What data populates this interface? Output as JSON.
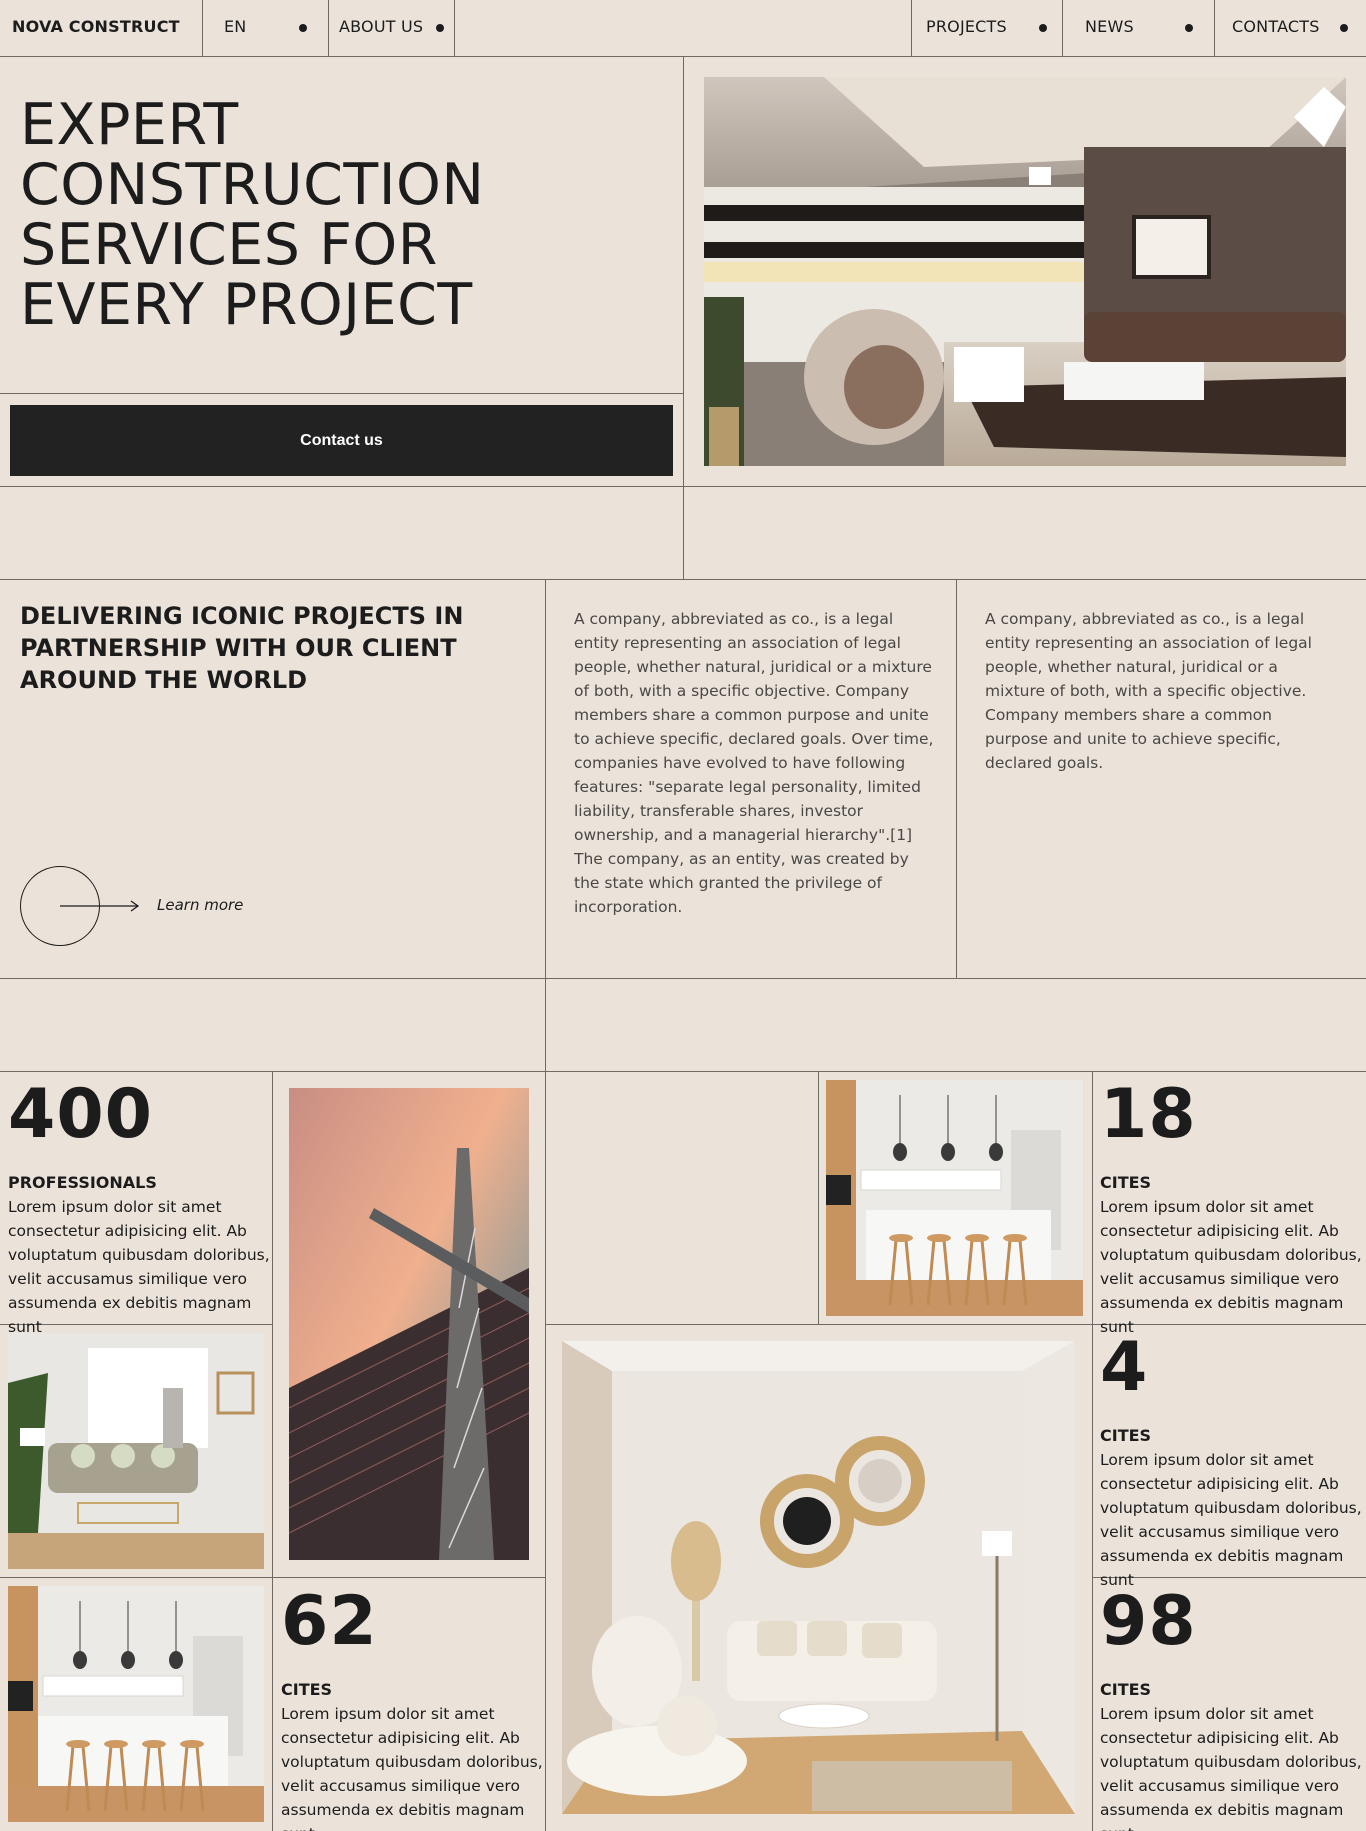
{
  "nav": {
    "brand": "NOVA CONSTRUCT",
    "language": "EN",
    "about": "ABOUT US",
    "projects": "PROJECTS",
    "news": "NEWS",
    "contacts": "CONTACTS"
  },
  "hero": {
    "title_lines": [
      "EXPERT",
      "CONSTRUCTION",
      "SERVICES FOR",
      "EVERY PROJECT"
    ],
    "contact_button": "Contact us"
  },
  "about": {
    "heading": "DELIVERING ICONIC PROJECTS IN PARTNERSHIP WITH OUR CLIENT AROUND THE WORLD",
    "learn_more": "Learn more",
    "paragraph_1": "A company, abbreviated as co., is a legal entity representing an association of legal people, whether natural, juridical or a mixture of both, with a specific objective. Company members share a common purpose and unite to achieve specific, declared goals. Over time, companies have evolved to have following features: \"separate legal personality, limited liability, transferable shares, investor ownership, and a managerial hierarchy\".[1] The company, as an entity, was created by the state which granted the privilege of incorporation.",
    "paragraph_2": "A company, abbreviated as co., is a legal entity representing an association of legal people, whether natural, juridical or a mixture of both, with a specific objective. Company members share a common purpose and unite to achieve specific, declared goals."
  },
  "stats": [
    {
      "number": "400",
      "label": "PROFESSIONALS",
      "description": "Lorem ipsum dolor sit amet consectetur adipisicing elit. Ab voluptatum quibusdam doloribus, velit accusamus similique vero assumenda ex debitis magnam sunt"
    },
    {
      "number": "18",
      "label": "CITES",
      "description": "Lorem ipsum dolor sit amet consectetur adipisicing elit. Ab voluptatum quibusdam doloribus, velit accusamus similique vero assumenda ex debitis magnam sunt"
    },
    {
      "number": "4",
      "label": "CITES",
      "description": "Lorem ipsum dolor sit amet consectetur adipisicing elit. Ab voluptatum quibusdam doloribus, velit accusamus similique vero assumenda ex debitis magnam sunt"
    },
    {
      "number": "62",
      "label": "CITES",
      "description": "Lorem ipsum dolor sit amet consectetur adipisicing elit. Ab voluptatum quibusdam doloribus, velit accusamus similique vero assumenda ex debitis magnam sunt"
    },
    {
      "number": "98",
      "label": "CITES",
      "description": "Lorem ipsum dolor sit amet consectetur adipisicing elit. Ab voluptatum quibusdam doloribus, velit accusamus similique vero assumenda ex debitis magnam sunt"
    }
  ],
  "colors": {
    "background": "#ebe3da",
    "text": "#1c1c1c",
    "button": "#222222",
    "lines": "#6e6a66"
  }
}
